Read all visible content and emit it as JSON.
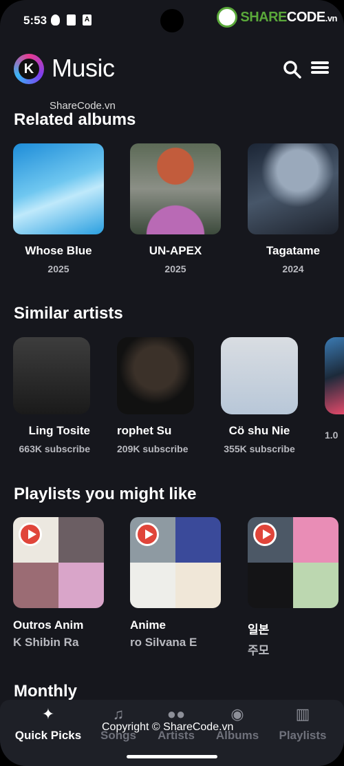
{
  "status_bar": {
    "time": "5:53",
    "a_icon": "A"
  },
  "watermark": {
    "logo_brand": "SHARE",
    "logo_code": "CODE",
    "logo_tld": ".vn",
    "text": "ShareCode.vn",
    "copyright": "Copyright © ShareCode.vn"
  },
  "header": {
    "logo_letter": "K",
    "title": "Music"
  },
  "sections": {
    "related_albums": "Related albums",
    "similar_artists": "Similar artists",
    "playlists": "Playlists you might like",
    "monthly": "Monthly"
  },
  "albums": [
    {
      "title": "Whose Blue",
      "year": "2025"
    },
    {
      "title": "UN-APEX",
      "year": "2025"
    },
    {
      "title": "Tagatame",
      "year": "2024"
    }
  ],
  "artists": [
    {
      "name": "Ling Tosite",
      "subs": "663K subscribe"
    },
    {
      "name": "rophet     Su",
      "subs": "209K subscribe"
    },
    {
      "name": "Cö shu Nie",
      "subs": "355K subscribe"
    },
    {
      "name": "",
      "subs": "1.0"
    }
  ],
  "playlists": [
    {
      "name": "Outros       Anim",
      "sub": "K       Shibin Ra"
    },
    {
      "name": "Anime",
      "sub": "ro       Silvana E"
    },
    {
      "name": "일본",
      "sub": "주모"
    }
  ],
  "bottom_nav": [
    {
      "label": "Quick Picks",
      "icon": "sparkles-icon"
    },
    {
      "label": "Songs",
      "icon": "music-note-icon"
    },
    {
      "label": "Artists",
      "icon": "people-icon"
    },
    {
      "label": "Albums",
      "icon": "disc-icon"
    },
    {
      "label": "Playlists",
      "icon": "library-icon"
    }
  ]
}
